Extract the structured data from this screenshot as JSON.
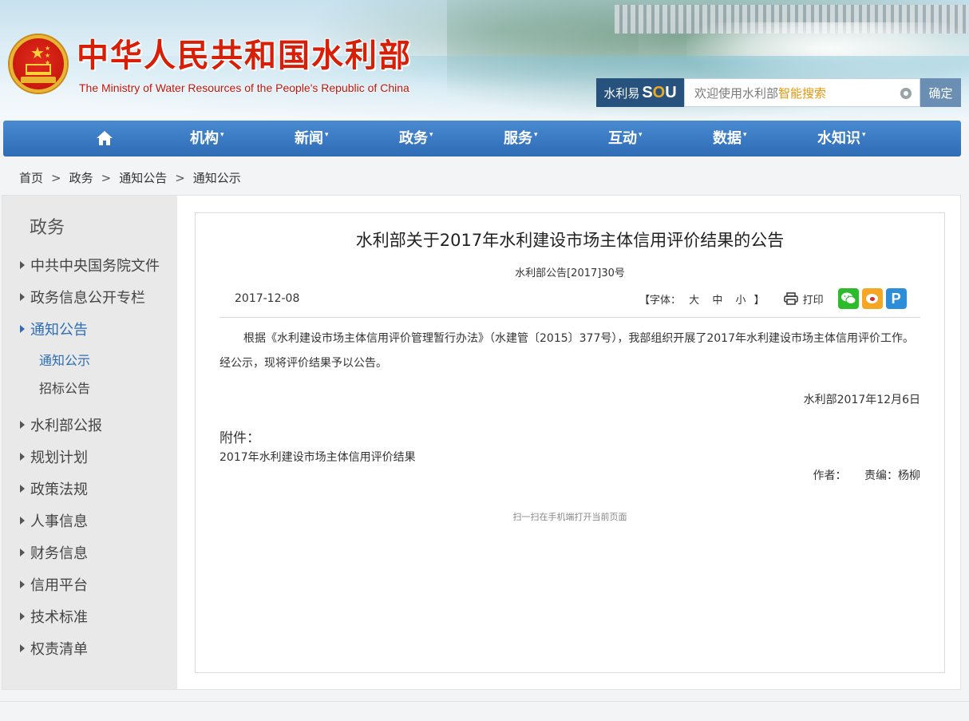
{
  "header": {
    "site_title": "中华人民共和国水利部",
    "site_subtitle": "The Ministry of Water Resources of the People's Republic of China",
    "emblem_icon": "national-emblem-icon"
  },
  "search": {
    "brand_prefix": "水利易",
    "brand_s": "S",
    "brand_o": "O",
    "brand_u": "U",
    "placeholder_main": "欢迎使用水利部",
    "placeholder_highlight": "智能搜索",
    "submit_label": "确定",
    "settings_icon": "gear-icon"
  },
  "nav": {
    "home_icon": "home-icon",
    "items": [
      {
        "label": "机构",
        "caret": "▾"
      },
      {
        "label": "新闻",
        "caret": "▾"
      },
      {
        "label": "政务",
        "caret": "▾"
      },
      {
        "label": "服务",
        "caret": "▾"
      },
      {
        "label": "互动",
        "caret": "▾"
      },
      {
        "label": "数据",
        "caret": "▾"
      },
      {
        "label": "水知识",
        "caret": "▾"
      }
    ]
  },
  "breadcrumb": {
    "items": [
      "首页",
      "政务",
      "通知公告",
      "通知公示"
    ],
    "separator": ">"
  },
  "sidebar": {
    "title": "政务",
    "items": [
      {
        "label": "中共中央国务院文件"
      },
      {
        "label": "政务信息公开专栏"
      },
      {
        "label": "通知公告",
        "active": true
      },
      {
        "label": "水利部公报"
      },
      {
        "label": "规划计划"
      },
      {
        "label": "政策法规"
      },
      {
        "label": "人事信息"
      },
      {
        "label": "财务信息"
      },
      {
        "label": "信用平台"
      },
      {
        "label": "技术标准"
      },
      {
        "label": "权责清单"
      }
    ],
    "subitems": [
      {
        "label": "通知公示",
        "active": true
      },
      {
        "label": "招标公告"
      }
    ]
  },
  "article": {
    "title": "水利部关于2017年水利建设市场主体信用评价结果的公告",
    "doc_number": "水利部公告[2017]30号",
    "date": "2017-12-08",
    "font_size_label": "【字体：",
    "font_size_close": "】",
    "font_large": "大",
    "font_medium": "中",
    "font_small": "小",
    "print_label": "打印",
    "print_icon": "printer-icon",
    "share_icons": [
      "wechat-icon",
      "weibo-icon",
      "people-share-icon"
    ],
    "people_letter": "P",
    "body": "根据《水利建设市场主体信用评价管理暂行办法》（水建管〔2015〕377号），我部组织开展了2017年水利建设市场主体信用评价工作。经公示，现将评价结果予以公告。",
    "signature": "水利部2017年12月6日",
    "attachment_label": "附件：",
    "attachment_link": "2017年水利建设市场主体信用评价结果",
    "author_label": "作者：",
    "author_value": "",
    "editor_label": "责编：",
    "editor_value": "杨柳",
    "qr_tip": "扫一扫在手机端打开当前页面"
  },
  "colors": {
    "nav_bg": "#3b7bc4",
    "title_red": "#d81e06",
    "active_blue": "#2d6db5",
    "search_brand_bg": "#27527e",
    "search_btn_bg": "#6b8fb3",
    "highlight_orange": "#e5960b"
  }
}
